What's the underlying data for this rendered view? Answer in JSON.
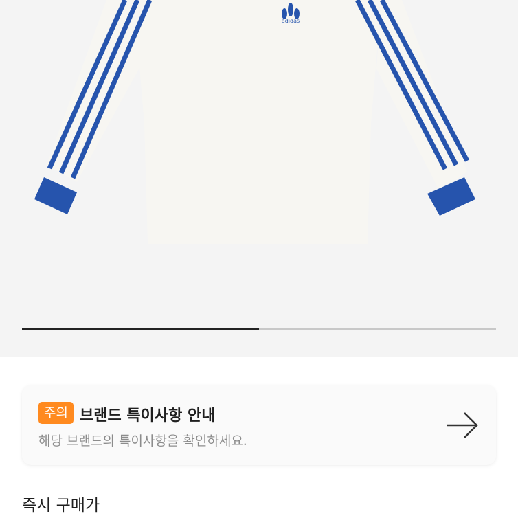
{
  "product_image": {
    "description_icon": "product-photo",
    "shirt_color": "#f7f6f2",
    "stripe_color": "#2654ad",
    "logo_text": "adidas"
  },
  "gallery": {
    "progress": 0.5
  },
  "notice": {
    "badge": "주의",
    "title": "브랜드 특이사항 안내",
    "subtitle": "해당 브랜드의 특이사항을 확인하세요.",
    "badge_color": "#ff8a1f",
    "arrow_icon": "arrow-right-icon"
  },
  "section": {
    "title": "즉시 구매가"
  }
}
